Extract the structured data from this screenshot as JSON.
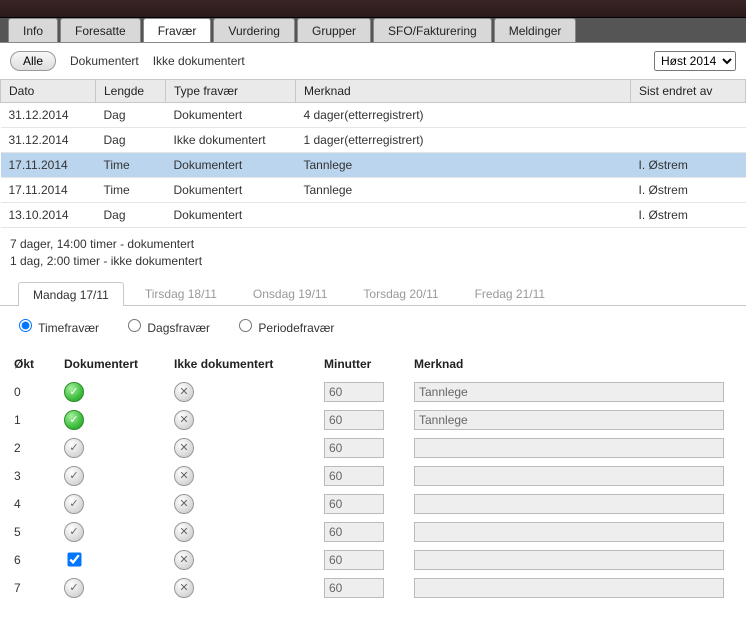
{
  "tabs": [
    {
      "label": "Info"
    },
    {
      "label": "Foresatte"
    },
    {
      "label": "Fravær"
    },
    {
      "label": "Vurdering"
    },
    {
      "label": "Grupper"
    },
    {
      "label": "SFO/Fakturering"
    },
    {
      "label": "Meldinger"
    }
  ],
  "active_tab": 2,
  "filters": {
    "alle": "Alle",
    "dokumentert": "Dokumentert",
    "ikke_dokumentert": "Ikke dokumentert"
  },
  "term_select": "Høst 2014",
  "columns": {
    "dato": "Dato",
    "lengde": "Lengde",
    "type": "Type fravær",
    "merknad": "Merknad",
    "sist_endret": "Sist endret av"
  },
  "rows": [
    {
      "dato": "31.12.2014",
      "lengde": "Dag",
      "type": "Dokumentert",
      "merknad": "4 dager(etterregistrert)",
      "sist": ""
    },
    {
      "dato": "31.12.2014",
      "lengde": "Dag",
      "type": "Ikke dokumentert",
      "merknad": "1 dager(etterregistrert)",
      "sist": ""
    },
    {
      "dato": "17.11.2014",
      "lengde": "Time",
      "type": "Dokumentert",
      "merknad": "Tannlege",
      "sist": "I. Østrem"
    },
    {
      "dato": "17.11.2014",
      "lengde": "Time",
      "type": "Dokumentert",
      "merknad": "Tannlege",
      "sist": "I. Østrem"
    },
    {
      "dato": "13.10.2014",
      "lengde": "Dag",
      "type": "Dokumentert",
      "merknad": "",
      "sist": "I. Østrem"
    }
  ],
  "selected_row": 2,
  "summary_line1": "7 dager, 14:00 timer - dokumentert",
  "summary_line2": "1 dag, 2:00 timer - ikke dokumentert",
  "daytabs": [
    {
      "label": "Mandag 17/11"
    },
    {
      "label": "Tirsdag 18/11"
    },
    {
      "label": "Onsdag 19/11"
    },
    {
      "label": "Torsdag 20/11"
    },
    {
      "label": "Fredag 21/11"
    }
  ],
  "active_daytab": 0,
  "radios": {
    "time": "Timefravær",
    "dag": "Dagsfravær",
    "periode": "Periodefravær"
  },
  "active_radio": "time",
  "detail_headers": {
    "okt": "Økt",
    "dok": "Dokumentert",
    "ikke": "Ikke dokumentert",
    "min": "Minutter",
    "merk": "Merknad"
  },
  "detail_rows": [
    {
      "okt": "0",
      "dok_state": "green",
      "ikke_icon": "x",
      "min": "60",
      "merk": "Tannlege",
      "checkbox": false
    },
    {
      "okt": "1",
      "dok_state": "green",
      "ikke_icon": "x",
      "min": "60",
      "merk": "Tannlege",
      "checkbox": false
    },
    {
      "okt": "2",
      "dok_state": "grey",
      "ikke_icon": "x",
      "min": "60",
      "merk": "",
      "checkbox": false
    },
    {
      "okt": "3",
      "dok_state": "grey",
      "ikke_icon": "x",
      "min": "60",
      "merk": "",
      "checkbox": false
    },
    {
      "okt": "4",
      "dok_state": "grey",
      "ikke_icon": "x",
      "min": "60",
      "merk": "",
      "checkbox": false
    },
    {
      "okt": "5",
      "dok_state": "grey",
      "ikke_icon": "x",
      "min": "60",
      "merk": "",
      "checkbox": false
    },
    {
      "okt": "6",
      "dok_state": "checkbox",
      "ikke_icon": "x",
      "min": "60",
      "merk": "",
      "checkbox": true
    },
    {
      "okt": "7",
      "dok_state": "grey",
      "ikke_icon": "x",
      "min": "60",
      "merk": "",
      "checkbox": false
    }
  ]
}
